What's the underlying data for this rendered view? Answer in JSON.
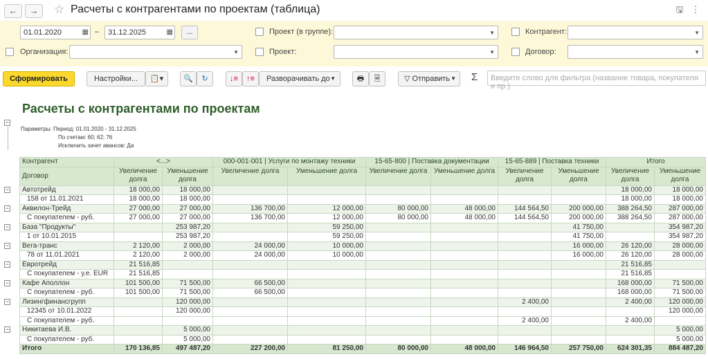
{
  "window": {
    "title": "Расчеты с контрагентами по проектам (таблица)",
    "back_label": "←",
    "forward_label": "→",
    "star_label": "☆",
    "save_label": "🖫",
    "menu_label": "⋮"
  },
  "filters": {
    "date_from": "01.01.2020",
    "date_to": "31.12.2025",
    "dash": "–",
    "more_label": "...",
    "org_label": "Организация:",
    "project_group_label": "Проект (в группе):",
    "project_label": "Проект:",
    "counterparty_label": "Контрагент:",
    "contract_label": "Договор:"
  },
  "toolbar": {
    "generate_label": "Сформировать",
    "settings_label": "Настройки...",
    "expand_label": "Разворачивать до",
    "send_label": "Отправить",
    "sigma": "Σ",
    "filter_placeholder": "Введите слово для фильтра (название товара, покупателя и пр.)"
  },
  "report": {
    "title": "Расчеты с контрагентами по проектам",
    "params": [
      "Параметры: Период: 01.01.2020 - 31.12.2025",
      "По счетам: 60; 62; 76",
      "Исключить зачет авансов: Да"
    ],
    "header1": [
      "Контрагент",
      "<...>",
      "000-001-001 | Услуги по монтажу техники",
      "15-65-800 | Поставка документации",
      "15-65-889 | Поставка техники",
      "Итого"
    ],
    "header2": [
      "Договор",
      "Увеличение долга",
      "Уменьшение долга",
      "Увеличение долга",
      "Уменьшение долга",
      "Увеличение долга",
      "Уменьшение долга",
      "Увеличение долга",
      "Уменьшение долга",
      "Увеличение долга",
      "Уменьшение долга"
    ],
    "rows": [
      {
        "level": 1,
        "name": "Автотрейд",
        "v": [
          "18 000,00",
          "18 000,00",
          "",
          "",
          "",
          "",
          "",
          "",
          "18 000,00",
          "18 000,00"
        ]
      },
      {
        "level": 2,
        "name": "158 от 11.01.2021",
        "v": [
          "18 000,00",
          "18 000,00",
          "",
          "",
          "",
          "",
          "",
          "",
          "18 000,00",
          "18 000,00"
        ]
      },
      {
        "level": 1,
        "name": "Аквилон-Трейд",
        "v": [
          "27 000,00",
          "27 000,00",
          "136 700,00",
          "12 000,00",
          "80 000,00",
          "48 000,00",
          "144 564,50",
          "200 000,00",
          "388 264,50",
          "287 000,00"
        ]
      },
      {
        "level": 2,
        "name": "С покупателем - руб.",
        "v": [
          "27 000,00",
          "27 000,00",
          "136 700,00",
          "12 000,00",
          "80 000,00",
          "48 000,00",
          "144 564,50",
          "200 000,00",
          "388 264,50",
          "287 000,00"
        ]
      },
      {
        "level": 1,
        "name": "База \"Продукты\"",
        "v": [
          "",
          "253 987,20",
          "",
          "59 250,00",
          "",
          "",
          "",
          "41 750,00",
          "",
          "354 987,20"
        ]
      },
      {
        "level": 2,
        "name": "1 от 10.01.2015",
        "v": [
          "",
          "253 987,20",
          "",
          "59 250,00",
          "",
          "",
          "",
          "41 750,00",
          "",
          "354 987,20"
        ]
      },
      {
        "level": 1,
        "name": "Вега-транс",
        "v": [
          "2 120,00",
          "2 000,00",
          "24 000,00",
          "10 000,00",
          "",
          "",
          "",
          "16 000,00",
          "26 120,00",
          "28 000,00"
        ]
      },
      {
        "level": 2,
        "name": "78 от 11.01.2021",
        "v": [
          "2 120,00",
          "2 000,00",
          "24 000,00",
          "10 000,00",
          "",
          "",
          "",
          "16 000,00",
          "26 120,00",
          "28 000,00"
        ]
      },
      {
        "level": 1,
        "name": "Евротрейд",
        "v": [
          "21 516,85",
          "",
          "",
          "",
          "",
          "",
          "",
          "",
          "21 516,85",
          ""
        ]
      },
      {
        "level": 2,
        "name": "С покупателем - у.е. EUR",
        "v": [
          "21 516,85",
          "",
          "",
          "",
          "",
          "",
          "",
          "",
          "21 516,85",
          ""
        ]
      },
      {
        "level": 1,
        "name": "Кафе Аполлон",
        "v": [
          "101 500,00",
          "71 500,00",
          "66 500,00",
          "",
          "",
          "",
          "",
          "",
          "168 000,00",
          "71 500,00"
        ]
      },
      {
        "level": 2,
        "name": "С покупателем - руб.",
        "v": [
          "101 500,00",
          "71 500,00",
          "66 500,00",
          "",
          "",
          "",
          "",
          "",
          "168 000,00",
          "71 500,00"
        ]
      },
      {
        "level": 1,
        "name": "Лизингфинансгрупп",
        "v": [
          "",
          "120 000,00",
          "",
          "",
          "",
          "",
          "2 400,00",
          "",
          "2 400,00",
          "120 000,00"
        ]
      },
      {
        "level": 2,
        "name": "12345 от 10.01.2022",
        "v": [
          "",
          "120 000,00",
          "",
          "",
          "",
          "",
          "",
          "",
          "",
          "120 000,00"
        ]
      },
      {
        "level": 2,
        "name": "С покупателем - руб.",
        "v": [
          "",
          "",
          "",
          "",
          "",
          "",
          "2 400,00",
          "",
          "2 400,00",
          ""
        ]
      },
      {
        "level": 1,
        "name": "Никитаева И.В.",
        "v": [
          "",
          "5 000,00",
          "",
          "",
          "",
          "",
          "",
          "",
          "",
          "5 000,00"
        ]
      },
      {
        "level": 2,
        "name": "С покупателем - руб.",
        "v": [
          "",
          "5 000,00",
          "",
          "",
          "",
          "",
          "",
          "",
          "",
          "5 000,00"
        ]
      }
    ],
    "total": {
      "name": "Итого",
      "v": [
        "170 136,85",
        "497 487,20",
        "227 200,00",
        "81 250,00",
        "80 000,00",
        "48 000,00",
        "146 964,50",
        "257 750,00",
        "624 301,35",
        "884 487,20"
      ]
    }
  }
}
